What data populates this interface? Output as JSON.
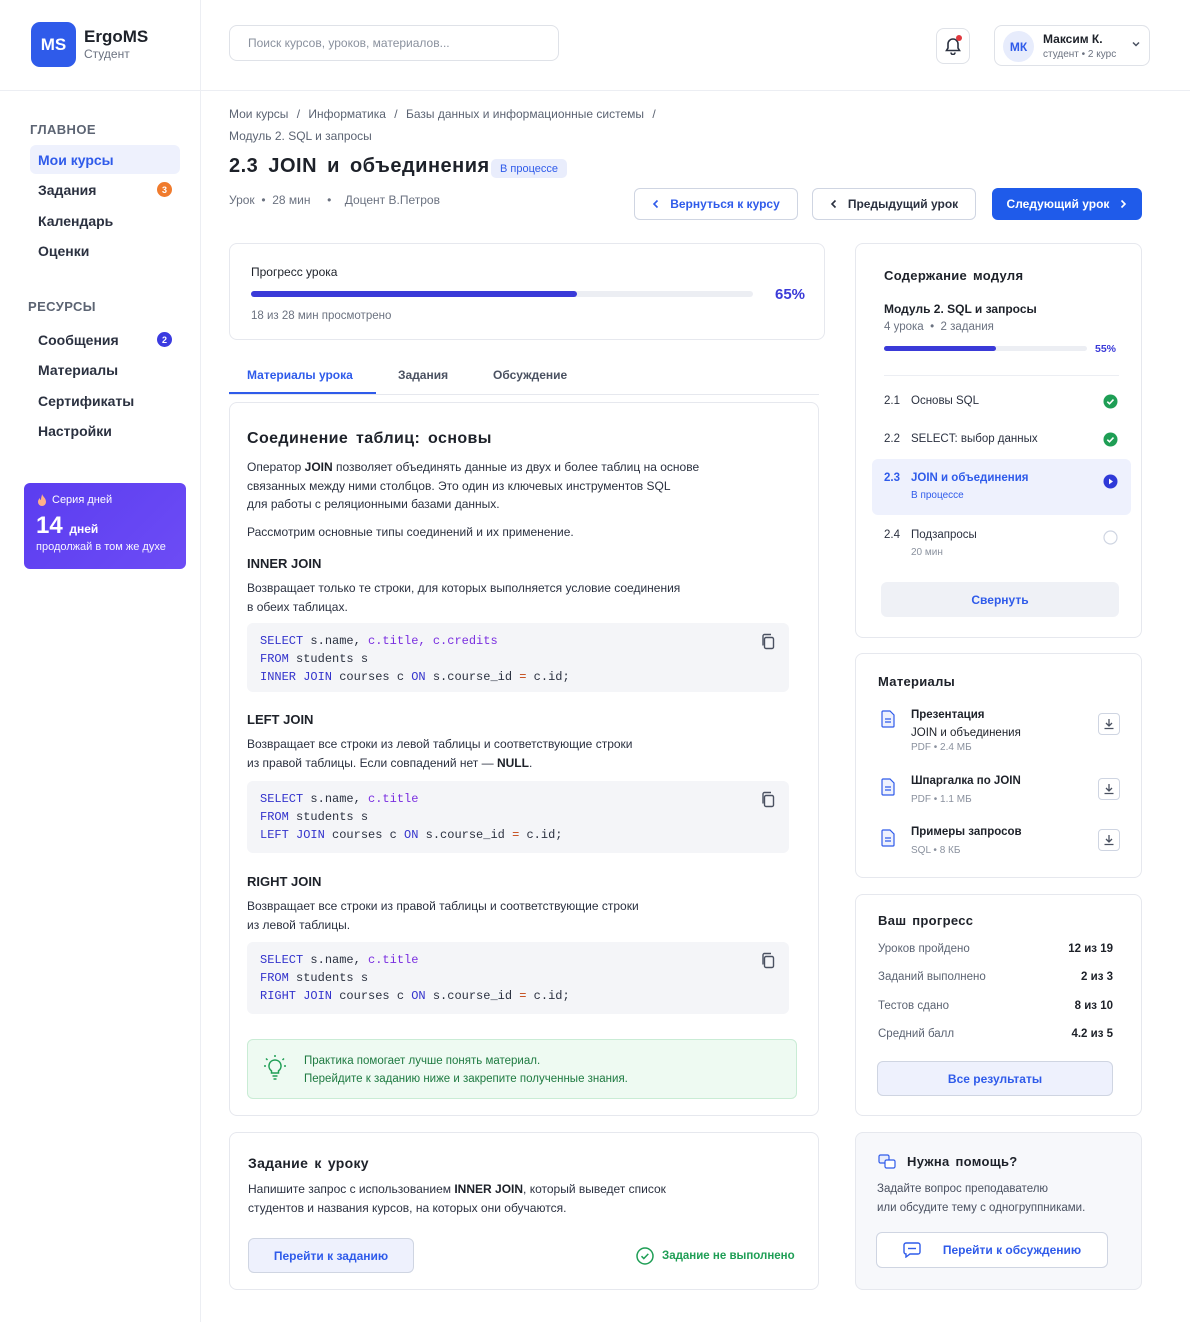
{
  "brand": {
    "logo": "MS",
    "name": "ErgoMS",
    "role": "Студент"
  },
  "search": {
    "placeholder": "Поиск курсов, уроков, материалов..."
  },
  "user": {
    "initials": "МК",
    "name": "Максим К.",
    "role": "студент • 2 курс"
  },
  "sidebar": {
    "main_title": "ГЛАВНОЕ",
    "main_items": [
      {
        "label": "Мои курсы",
        "active": true
      },
      {
        "label": "Задания",
        "badge": "3"
      },
      {
        "label": "Календарь"
      },
      {
        "label": "Оценки"
      }
    ],
    "res_title": "РЕСУРСЫ",
    "res_items": [
      {
        "label": "Сообщения",
        "badge": "2"
      },
      {
        "label": "Материалы"
      },
      {
        "label": "Сертификаты"
      },
      {
        "label": "Настройки"
      }
    ],
    "streak": {
      "label": "Серия дней",
      "value": "14",
      "unit": "дней",
      "sub": "продолжай в том же духе"
    }
  },
  "breadcrumb": {
    "items": [
      "Мои курсы",
      "Информатика",
      "Базы данных и информационные системы"
    ],
    "sep": "/",
    "last": "Модуль 2. SQL и запросы"
  },
  "lesson": {
    "title": "2.3  JOIN  и  объединения",
    "status": "В процессе",
    "meta": "Урок  •  28 мин     •    Доцент В.Петров",
    "back": "Вернуться к курсу",
    "prev": "Предыдущий урок",
    "next": "Следующий урок"
  },
  "progress": {
    "title": "Прогресс урока",
    "percent_label": "65%",
    "value": 0.65,
    "caption": "18 из 28 мин просмотрено"
  },
  "tabs": [
    "Материалы урока",
    "Задания",
    "Обсуждение"
  ],
  "content": {
    "heading": "Соединение  таблиц:  основы",
    "intro_1a": "Оператор ",
    "intro_1b": "JOIN",
    "intro_1c": " позволяет объединять данные из двух и более таблиц на основе",
    "intro_2": "связанных между ними столбцов. Это один из ключевых инструментов SQL",
    "intro_3": "для работы с реляционными базами данных.",
    "intro_4": "Рассмотрим основные типы соединений и их применение.",
    "inner": {
      "title": "INNER JOIN",
      "l1": "Возвращает только те строки, для которых выполняется условие соединения",
      "l2": "в обеих таблицах."
    },
    "left": {
      "title": "LEFT JOIN",
      "l1": "Возвращает все строки из левой таблицы и соответствующие строки",
      "l2a": "из правой таблицы. Если совпадений нет — ",
      "l2b": "NULL",
      "l2c": "."
    },
    "right": {
      "title": "RIGHT JOIN",
      "l1": "Возвращает все строки из правой таблицы и соответствующие строки",
      "l2": "из левой таблицы."
    },
    "code1": {
      "k1": "SELECT",
      "a1": " s.name, ",
      "p1": "c.title, c.credits",
      "k2": "FROM",
      "a2": " students s",
      "k3": "INNER JOIN",
      "a3": " courses c ",
      "k4": "ON",
      "a4": " s.course_id ",
      "o": "=",
      "a5": " c.id;"
    },
    "code2": {
      "k1": "SELECT",
      "a1": " s.name, ",
      "p1": "c.title",
      "k2": "FROM",
      "a2": " students s",
      "k3": "LEFT JOIN",
      "a3": " courses c ",
      "k4": "ON",
      "a4": " s.course_id ",
      "o": "=",
      "a5": " c.id;"
    },
    "code3": {
      "k1": "SELECT",
      "a1": " s.name, ",
      "p1": "c.title",
      "k2": "FROM",
      "a2": " students s",
      "k3": "RIGHT JOIN",
      "a3": " courses c ",
      "k4": "ON",
      "a4": " s.course_id ",
      "o": "=",
      "a5": " c.id;"
    },
    "tip_1": "Практика помогает лучше понять материал.",
    "tip_2": "Перейдите к заданию ниже и закрепите полученные знания."
  },
  "task": {
    "title": "Задание  к  уроку",
    "l1a": "Напишите запрос с использованием ",
    "l1b": "INNER JOIN",
    "l1c": ", который выведет список",
    "l2": "студентов и названия курсов, на которых они обучаются.",
    "button": "Перейти к заданию",
    "status": "Задание не выполнено"
  },
  "module": {
    "title": "Содержание  модуля",
    "name": "Модуль 2. SQL и запросы",
    "meta": "4 урока  •  2 задания",
    "percent_label": "55%",
    "value": 0.55,
    "lessons": [
      {
        "num": "2.1",
        "name": "Основы SQL",
        "state": "done"
      },
      {
        "num": "2.2",
        "name": "SELECT: выбор данных",
        "state": "done"
      },
      {
        "num": "2.3",
        "name": "JOIN и объединения",
        "sub": "В процессе",
        "state": "current"
      },
      {
        "num": "2.4",
        "name": "Подзапросы",
        "sub": "20 мин",
        "state": "todo"
      }
    ],
    "collapse": "Свернуть"
  },
  "materials": {
    "title": "Материалы",
    "items": [
      {
        "name": "Презентация",
        "name2": "JOIN и объединения",
        "meta": "PDF • 2.4 МБ"
      },
      {
        "name": "Шпаргалка по JOIN",
        "meta": "PDF • 1.1 МБ"
      },
      {
        "name": "Примеры запросов",
        "meta": "SQL • 8 КБ"
      }
    ]
  },
  "your_progress": {
    "title": "Ваш  прогресс",
    "rows": [
      {
        "label": "Уроков пройдено",
        "value": "12 из 19"
      },
      {
        "label": "Заданий выполнено",
        "value": "2 из 3"
      },
      {
        "label": "Тестов сдано",
        "value": "8 из 10"
      },
      {
        "label": "Средний балл",
        "value": "4.2 из 5"
      }
    ],
    "button": "Все результаты"
  },
  "help": {
    "title": "Нужна  помощь?",
    "l1": "Задайте вопрос преподавателю",
    "l2": "или обсудите тему с одногруппниками.",
    "button": "Перейти к обсуждению"
  },
  "colors": {
    "accent": "#2f5bea",
    "progress": "#3a3ad8",
    "success": "#1e9e55",
    "streak": "#5b3df0"
  }
}
